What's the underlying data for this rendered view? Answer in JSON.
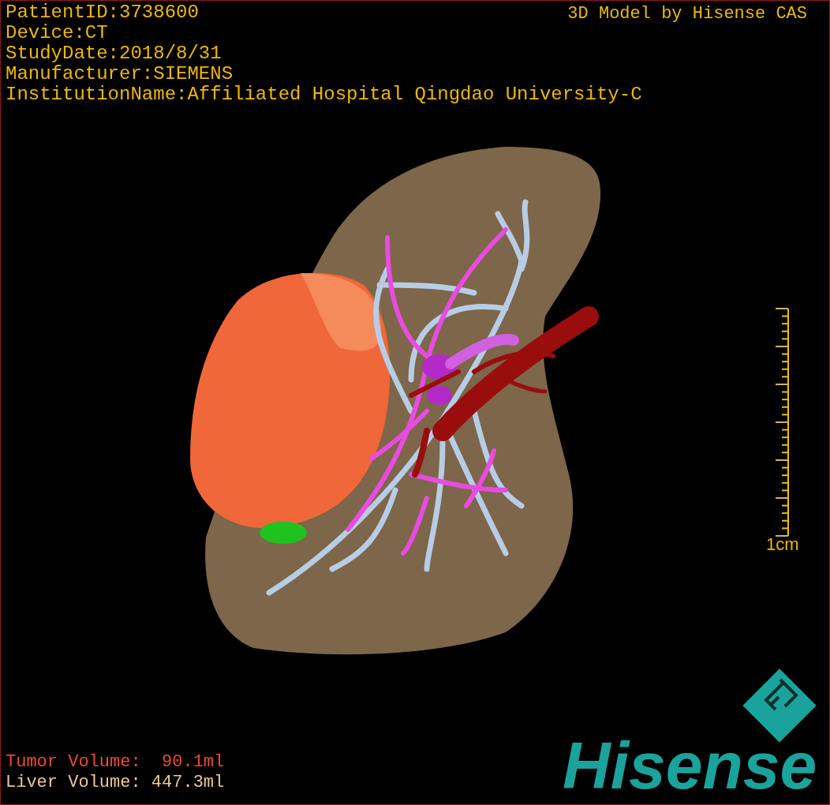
{
  "viewport_caption": "3D Model by Hisense CAS",
  "info_lines": [
    "PatientID:3738600",
    "Device:CT",
    "StudyDate:2018/8/31",
    "Manufacturer:SIEMENS",
    "InstitutionName:Affiliated Hospital Qingdao University-C"
  ],
  "scale_bar": {
    "label": "1cm"
  },
  "volumes": [
    {
      "kind": "tumor",
      "label": "Tumor Volume:",
      "value": "  90.1ml"
    },
    {
      "kind": "liver",
      "label": "Liver Volume:",
      "value": " 447.3ml"
    }
  ],
  "logo": {
    "text": "Hisense"
  }
}
